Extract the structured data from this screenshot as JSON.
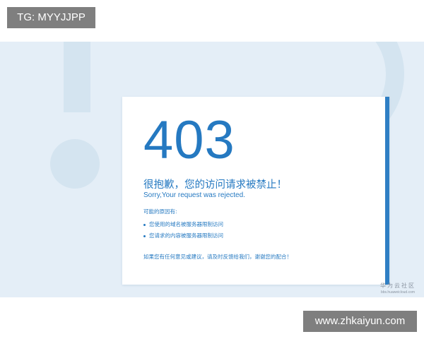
{
  "overlay": {
    "tag": "TG: MYYJJPP",
    "site": "www.zhkaiyun.com"
  },
  "error": {
    "code": "403",
    "title_cn": "很抱歉，您的访问请求被禁止！",
    "title_en": "Sorry,Your request was rejected.",
    "reasons_label": "可能的原因有:",
    "reasons": [
      "您使用的域名被服务器限制访问",
      "您请求的内容被服务器限制访问"
    ],
    "footer": "如果您有任何意见或建议，请及时反馈给我们，谢谢您的配合！"
  },
  "brand": {
    "name": "华为云社区",
    "url": "bbs.huaweicloud.com"
  },
  "colors": {
    "accent": "#2579c1",
    "accent_bar": "#2f7fc4",
    "background": "#e4eef7",
    "decor": "#d4e4f0",
    "overlay_bg": "#7f7f7f"
  }
}
